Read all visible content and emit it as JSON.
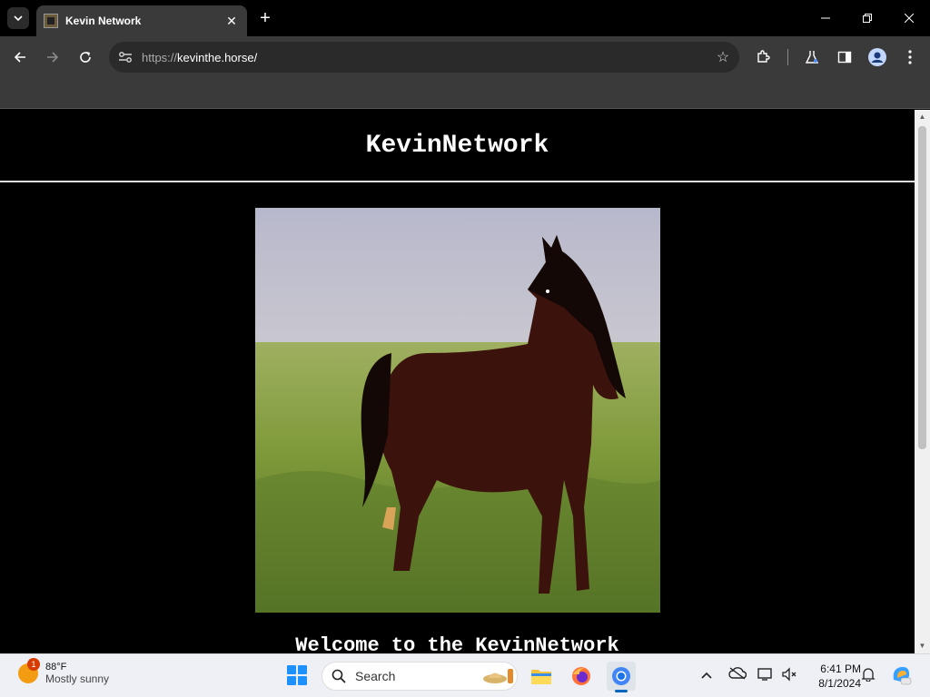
{
  "browser": {
    "tab_title": "Kevin Network",
    "url_scheme": "https://",
    "url_host": "kevinthe.horse/",
    "new_tab": "+"
  },
  "page": {
    "site_title": "KevinNetwork",
    "welcome_text": "Welcome to the KevinNetwork"
  },
  "taskbar": {
    "weather_temp": "88°F",
    "weather_condition": "Mostly sunny",
    "weather_badge": "1",
    "search_label": "Search",
    "time": "6:41 PM",
    "date": "8/1/2024"
  },
  "colors": {
    "browser_chrome": "#3a3a3a",
    "page_bg": "#000000",
    "taskbar_bg": "#eef0f5",
    "accent": "#0067c0"
  }
}
